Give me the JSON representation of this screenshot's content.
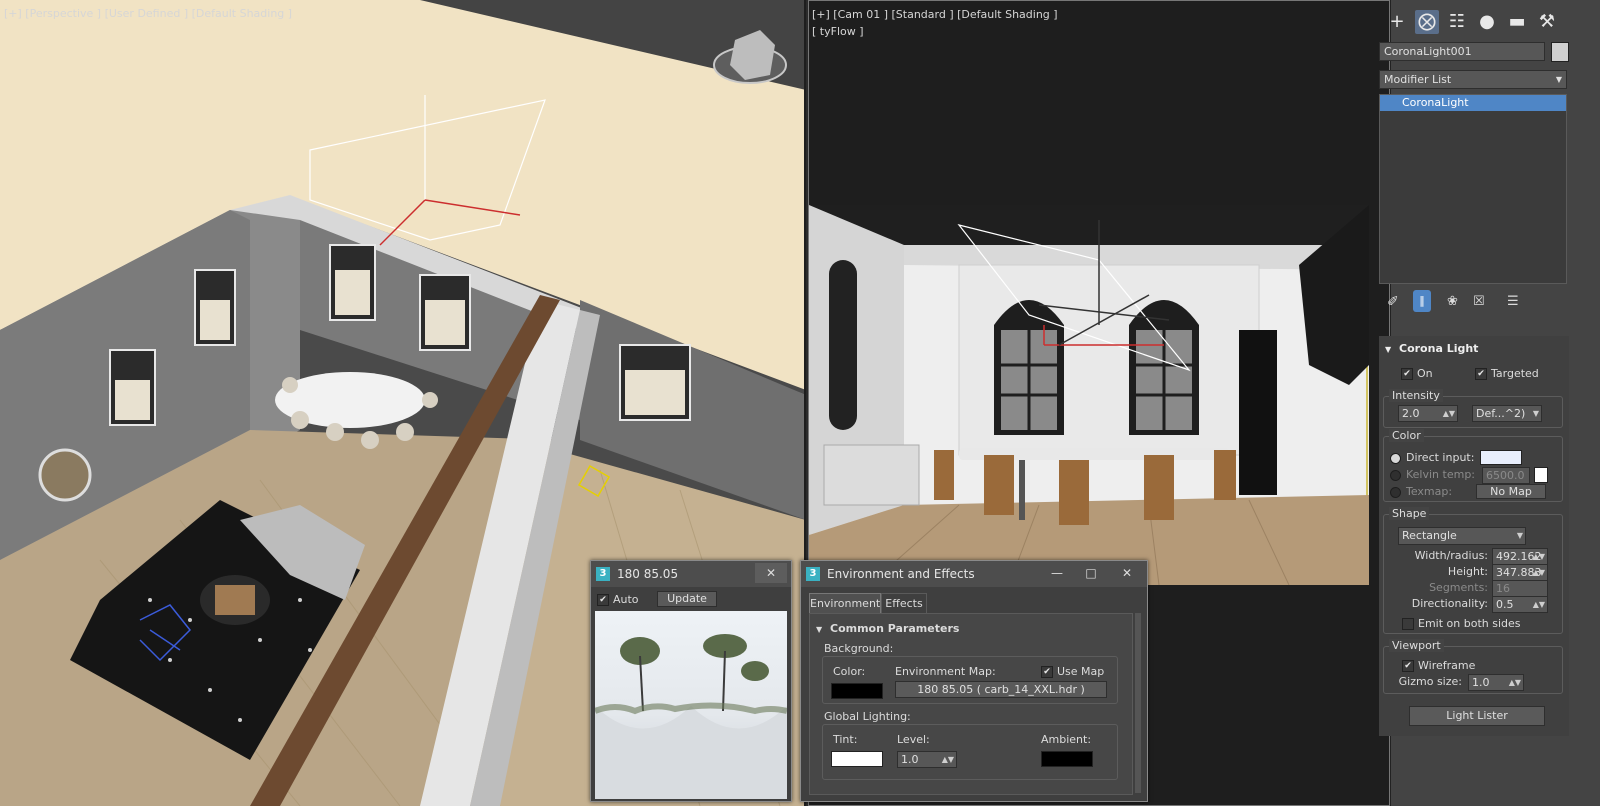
{
  "left_viewport": {
    "label": "[+] [Perspective ] [User Defined ] [Default Shading ]"
  },
  "right_viewport": {
    "label": "[+] [Cam 01 ] [Standard ] [Default Shading ]",
    "sublabel": "[ tyFlow ]"
  },
  "command_panel": {
    "tabs": [
      "create-icon",
      "modify-icon",
      "hierarchy-icon",
      "motion-icon",
      "display-icon",
      "utilities-icon"
    ],
    "object_name": "CoronaLight001",
    "modifier_list": "Modifier List",
    "stack_item": "CoronaLight",
    "rollout_title": "Corona Light",
    "on_label": "On",
    "targeted_label": "Targeted",
    "intensity": {
      "title": "Intensity",
      "value": "2.0",
      "unit": "Def...^2)"
    },
    "color": {
      "title": "Color",
      "direct_input": "Direct input:",
      "kelvin_temp": "Kelvin temp:",
      "kelvin_value": "6500.0",
      "texmap": "Texmap:",
      "no_map": "No Map",
      "swatch": "#e8eefc"
    },
    "shape": {
      "title": "Shape",
      "type": "Rectangle",
      "width_label": "Width/radius:",
      "width_value": "492.162",
      "height_label": "Height:",
      "height_value": "347.883",
      "segments_label": "Segments:",
      "segments_value": "16",
      "directionality_label": "Directionality:",
      "directionality_value": "0.5",
      "emit_both": "Emit on both sides"
    },
    "viewport": {
      "title": "Viewport",
      "wireframe": "Wireframe",
      "gizmo_label": "Gizmo size:",
      "gizmo_value": "1.0"
    },
    "light_lister": "Light Lister"
  },
  "preview_dialog": {
    "title": "180 85.05",
    "auto_label": "Auto",
    "update_label": "Update"
  },
  "env_dialog": {
    "title": "Environment and Effects",
    "tabs": [
      "Environment",
      "Effects"
    ],
    "rollout": "Common Parameters",
    "background": {
      "title": "Background:",
      "color_label": "Color:",
      "env_map_label": "Environment Map:",
      "use_map_label": "Use Map",
      "map_name": "180 85.05 ( carb_14_XXL.hdr )"
    },
    "global_lighting": {
      "title": "Global Lighting:",
      "tint_label": "Tint:",
      "level_label": "Level:",
      "level_value": "1.0",
      "ambient_label": "Ambient:"
    }
  },
  "colors": {
    "selection": "#4f86c6",
    "accent_yellow": "#c8b632",
    "panel_bg": "#444444"
  }
}
